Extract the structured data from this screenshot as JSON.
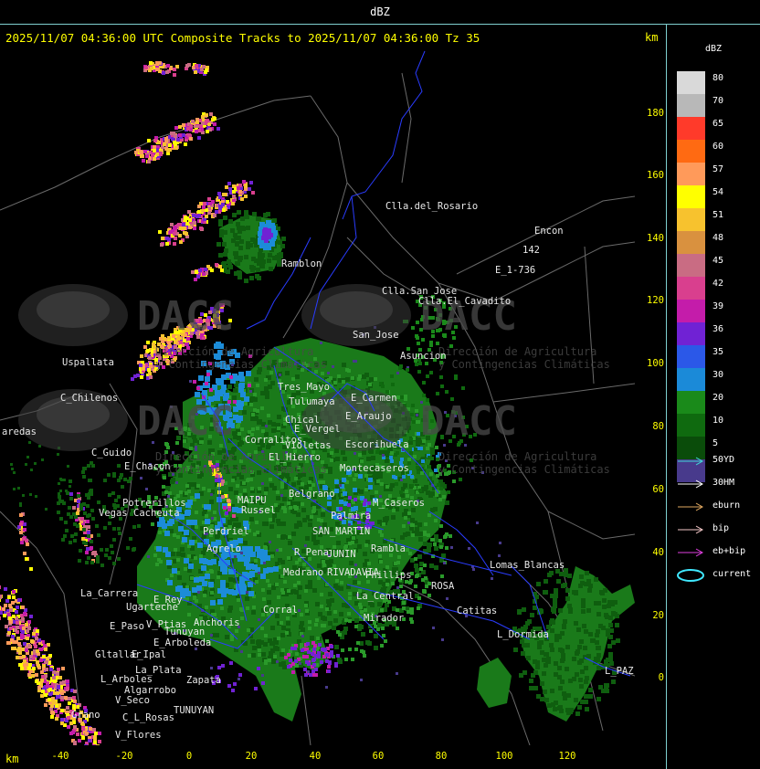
{
  "window": {
    "title": "dBZ"
  },
  "header": {
    "subtitle": "2025/11/07 04:36:00 UTC Composite Tracks to 2025/11/07 04:36:00 Tz 35",
    "km_top": "km",
    "km_bottom": "km"
  },
  "legend": {
    "title": "dBZ",
    "bins": [
      {
        "label": "80",
        "color": "#d9d9d9"
      },
      {
        "label": "70",
        "color": "#b8b8b8"
      },
      {
        "label": "65",
        "color": "#ff3a2a"
      },
      {
        "label": "60",
        "color": "#ff6a12"
      },
      {
        "label": "57",
        "color": "#ff9a5a"
      },
      {
        "label": "54",
        "color": "#ffff00"
      },
      {
        "label": "51",
        "color": "#f7c22e"
      },
      {
        "label": "48",
        "color": "#d9913f"
      },
      {
        "label": "45",
        "color": "#c96c83"
      },
      {
        "label": "42",
        "color": "#d93f8e"
      },
      {
        "label": "39",
        "color": "#c41caa"
      },
      {
        "label": "36",
        "color": "#7022d4"
      },
      {
        "label": "35",
        "color": "#2b58e8"
      },
      {
        "label": "30",
        "color": "#1b8ad8"
      },
      {
        "label": "20",
        "color": "#1a8a1a"
      },
      {
        "label": "10",
        "color": "#0f6a0f"
      },
      {
        "label": "5",
        "color": "#0a4c0a"
      },
      {
        "label": "",
        "color": "#483a8c"
      }
    ]
  },
  "tracks": [
    {
      "label": "50YD",
      "color": "#40d8d8"
    },
    {
      "label": "30HM",
      "color": "#ffffff"
    },
    {
      "label": "eburn",
      "color": "#e0a860"
    },
    {
      "label": "bip",
      "color": "#f4c8c8"
    },
    {
      "label": "eb+bip",
      "color": "#e040e0"
    },
    {
      "label": "current",
      "color": "#40e8ff"
    }
  ],
  "axes": {
    "y_ticks": [
      "180",
      "160",
      "140",
      "120",
      "100",
      "80",
      "60",
      "40",
      "20",
      "0"
    ],
    "x_ticks": [
      "-40",
      "-20",
      "0",
      "20",
      "40",
      "60",
      "80",
      "100",
      "120"
    ]
  },
  "watermark": {
    "name": "DACC",
    "line1": "Dirección de Agricultura",
    "line2": "y Contingencias Climáticas"
  },
  "places": [
    {
      "name": "Clla.del_Rosario"
    },
    {
      "name": "Encon"
    },
    {
      "name": "142"
    },
    {
      "name": "E_1-736"
    },
    {
      "name": "Ramblon"
    },
    {
      "name": "Clla.San_Jose"
    },
    {
      "name": "Clla.El_Cavadito"
    },
    {
      "name": "San_Jose"
    },
    {
      "name": "Asuncion"
    },
    {
      "name": "Uspallata"
    },
    {
      "name": "C_Chilenos"
    },
    {
      "name": "aredas"
    },
    {
      "name": "C_Guido"
    },
    {
      "name": "E_Chacon"
    },
    {
      "name": "Potrerillos"
    },
    {
      "name": "Vegas"
    },
    {
      "name": "Cacheuta"
    },
    {
      "name": "Tres_Mayo"
    },
    {
      "name": "Tulumaya"
    },
    {
      "name": "E_Carmen"
    },
    {
      "name": "E_Araujo"
    },
    {
      "name": "Chical"
    },
    {
      "name": "E_Vergel"
    },
    {
      "name": "Violetas"
    },
    {
      "name": "Escorihuela"
    },
    {
      "name": "Corralitos"
    },
    {
      "name": "El_Hierro"
    },
    {
      "name": "Montecaseros"
    },
    {
      "name": "Belgrano"
    },
    {
      "name": "M_Caseros"
    },
    {
      "name": "MAIPU"
    },
    {
      "name": "Russel"
    },
    {
      "name": "Perdriel"
    },
    {
      "name": "Agrelo"
    },
    {
      "name": "SAN_MARTIN"
    },
    {
      "name": "Palmira"
    },
    {
      "name": "Rambla"
    },
    {
      "name": "R_Pena"
    },
    {
      "name": "JUNIN"
    },
    {
      "name": "Medrano"
    },
    {
      "name": "RIVADAVIA"
    },
    {
      "name": "Phillips"
    },
    {
      "name": "La_Central"
    },
    {
      "name": "Mirador"
    },
    {
      "name": "ROSA"
    },
    {
      "name": "Catitas"
    },
    {
      "name": "Lomas_Blancas"
    },
    {
      "name": "L_Dormida"
    },
    {
      "name": "L_PAZ"
    },
    {
      "name": "La_Carrera"
    },
    {
      "name": "E_Rey"
    },
    {
      "name": "Ugarteche"
    },
    {
      "name": "E_Paso"
    },
    {
      "name": "V_Ptias"
    },
    {
      "name": "Anchoris"
    },
    {
      "name": "Tunuyan"
    },
    {
      "name": "E_Arboleda"
    },
    {
      "name": "Gltallar"
    },
    {
      "name": "E_Ipal"
    },
    {
      "name": "L_Arboles"
    },
    {
      "name": "La_Plata"
    },
    {
      "name": "Zapata"
    },
    {
      "name": "Algarrobo"
    },
    {
      "name": "V_Seco"
    },
    {
      "name": "TUNUYAN"
    },
    {
      "name": "Grano"
    },
    {
      "name": "C_L_Rosas"
    },
    {
      "name": "V_Flores"
    },
    {
      "name": "Corral"
    }
  ]
}
